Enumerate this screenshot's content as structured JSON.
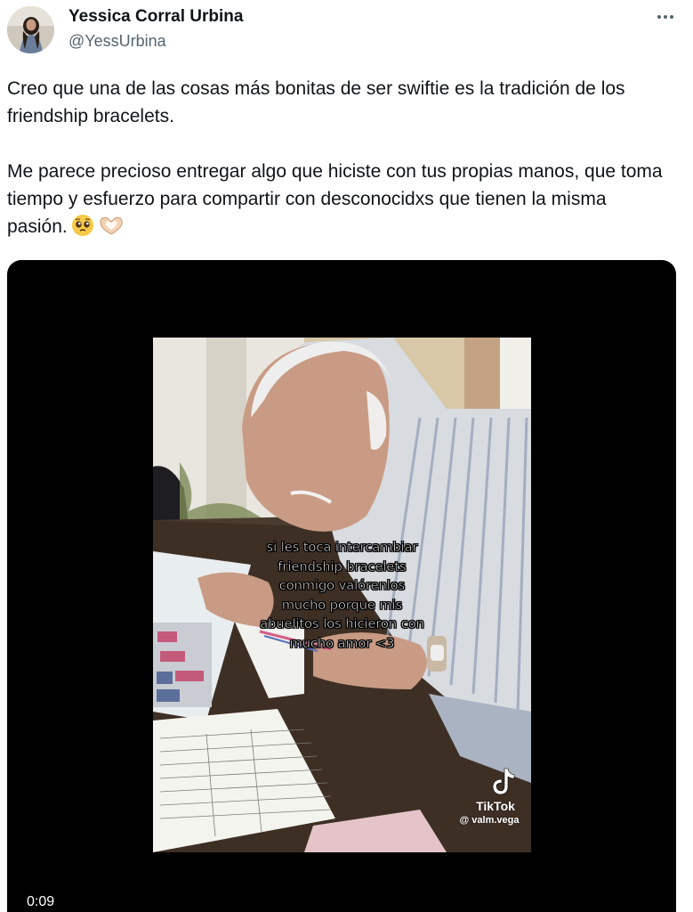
{
  "author": {
    "name": "Yessica Corral Urbina",
    "handle": "@YessUrbina"
  },
  "tweet": {
    "paragraph1": "Creo que una de las cosas más bonitas de ser swiftie es la tradición de los friendship bracelets.",
    "paragraph2": "Me parece precioso entregar algo que hiciste con tus propias manos, que toma tiempo y esfuerzo para compartir con desconocidxs que tienen la misma pasión.",
    "emojis": [
      "pleading-face-emoji",
      "heart-hands-emoji"
    ]
  },
  "media": {
    "caption": "si les toca intercambiar\nfriendship bracelets\nconmigo valórenlos\nmucho porque mis\nabuelitos los hicieron con\nmucho amor <3",
    "watermark_brand": "TikTok",
    "watermark_user": "@ valm.vega",
    "duration": "0:09"
  },
  "icons": {
    "more": "more-horizontal-icon",
    "tiktok": "tiktok-logo-icon"
  }
}
